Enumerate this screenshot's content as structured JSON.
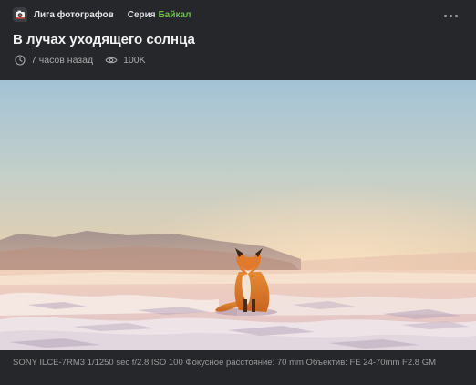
{
  "community": {
    "name": "Лига фотографов",
    "avatar_icon": "camera-icon"
  },
  "series": {
    "label": "Серия",
    "name": "Байкал",
    "color": "#6fbf4a"
  },
  "post": {
    "title": "В лучах уходящего солнца",
    "time_ago": "7 часов назад",
    "views": "100K",
    "time_icon": "clock-icon",
    "views_icon": "eye-icon",
    "more_icon": "more-dots-icon"
  },
  "photo": {
    "subject": "fox-photo",
    "exif": "SONY ILCE-7RM3 1/1250 sec f/2.8 ISO 100 Фокусное расстояние: 70 mm Объектив: FE 24-70mm F2.8 GM"
  },
  "colors": {
    "background": "#25272a",
    "accent": "#6fbf4a"
  }
}
